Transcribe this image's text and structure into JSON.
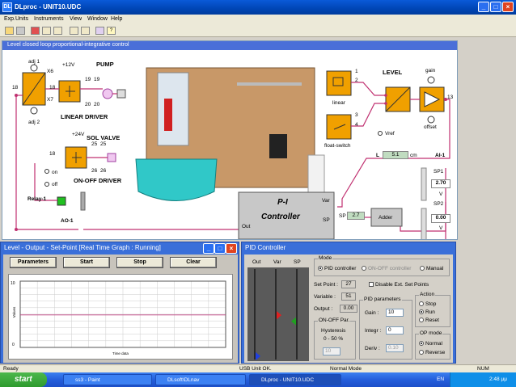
{
  "window": {
    "title": "DLproc - UNIT10.UDC"
  },
  "menu": [
    "Exp.Units",
    "Instruments",
    "View",
    "Window",
    "Help"
  ],
  "schematic": {
    "title": "Level closed loop proportional-integrative control",
    "adj1": "adj 1",
    "adj2": "adj 2",
    "x6": "X6",
    "x7": "X7",
    "v12": "+12V",
    "v24": "+24V",
    "pump": "PUMP",
    "linear_driver": "LINEAR DRIVER",
    "sol_valve": "SOL VALVE",
    "onoff_driver": "ON-OFF DRIVER",
    "level": "LEVEL",
    "gain": "gain",
    "offset": "offset",
    "linear": "linear",
    "float_switch": "float-switch",
    "vref": "Vref",
    "on": "on",
    "off": "off",
    "relay": "Relay-1",
    "ao": "AO-1",
    "ai": "AI-1",
    "l_label": "L",
    "l_value": "5.1",
    "l_unit": "cm",
    "sp1_label": "SP1",
    "sp1_value": "2.70",
    "sp1_unit": "V",
    "sp2_label": "SP2",
    "sp2_value": "0.00",
    "sp2_unit": "V",
    "controller_line1": "P-I",
    "controller_line2": "Controller",
    "var": "Var",
    "sp": "SP",
    "out": "Out",
    "sp_box_label": "SP",
    "sp_box_value": "2.7",
    "adder": "Adder",
    "pins": {
      "p18a": "18",
      "p18b": "18",
      "p18c": "18",
      "p19a": "19",
      "p19b": "19",
      "p19c": "19",
      "p20a": "20",
      "p20b": "20",
      "p25a": "25",
      "p25b": "25",
      "p26a": "26",
      "p26b": "26",
      "p1": "1",
      "p2": "2",
      "p3": "3",
      "p4": "4",
      "p13": "13"
    }
  },
  "graph": {
    "title": "Level - Output - Set-Point [Real Time Graph : Running]",
    "buttons": {
      "parameters": "Parameters",
      "start": "Start",
      "stop": "Stop",
      "clear": "Clear"
    },
    "legend": [
      "",
      "",
      ""
    ],
    "xlabel": "Time data",
    "ylabel": "Values",
    "ytick_max": "10",
    "ytick_min": "0",
    "set_level": 0.49
  },
  "pid": {
    "title": "PID Controller",
    "bar_labels": {
      "out": "Out",
      "var": "Var",
      "sp": "SP"
    },
    "bars": {
      "out": 0.02,
      "var": 0.49,
      "sp": 0.42
    },
    "mode": {
      "title": "Mode",
      "pid_label": "PID controller",
      "onoff_label": "ON-OFF controller",
      "manual_label": "Manual"
    },
    "set_point_label": "Set Point :",
    "set_point_value": "27",
    "variable_label": "Variable :",
    "variable_value": "51",
    "output_label": "Output :",
    "output_value": "0.00",
    "disable_label": "Disable Ext. Set Points",
    "onoff_par": {
      "title": "ON-OFF Par.",
      "hysteresis": "Hysteresis",
      "range": "0 - 50 %",
      "value": "10"
    },
    "pid_params": {
      "title": "PID parameters",
      "gain_label": "Gain :",
      "gain_value": "10",
      "integr_label": "Integr :",
      "integr_value": "0",
      "deriv_label": "Deriv :",
      "deriv_value": "0.10"
    },
    "action": {
      "title": "Action",
      "stop": "Stop",
      "run": "Run",
      "reset": "Reset"
    },
    "op_mode": {
      "title": "OP mode",
      "normal": "Normal",
      "reverse": "Reverse"
    }
  },
  "status": {
    "left": "Ready",
    "usb": "USB Unit OK.",
    "mode": "Normal Mode",
    "num": "NUM"
  },
  "taskbar": {
    "start": "start",
    "tasks": [
      "ss3 - Paint",
      "DLsoft\\DLnav",
      "DLproc - UNIT10.UDC"
    ],
    "lang": "EN",
    "clock": "2:48 μμ"
  },
  "colors": {
    "accent": "#3a6fd9",
    "controller": "#c8c8c8",
    "wire": "#c03070",
    "orange": "#f0a000"
  }
}
